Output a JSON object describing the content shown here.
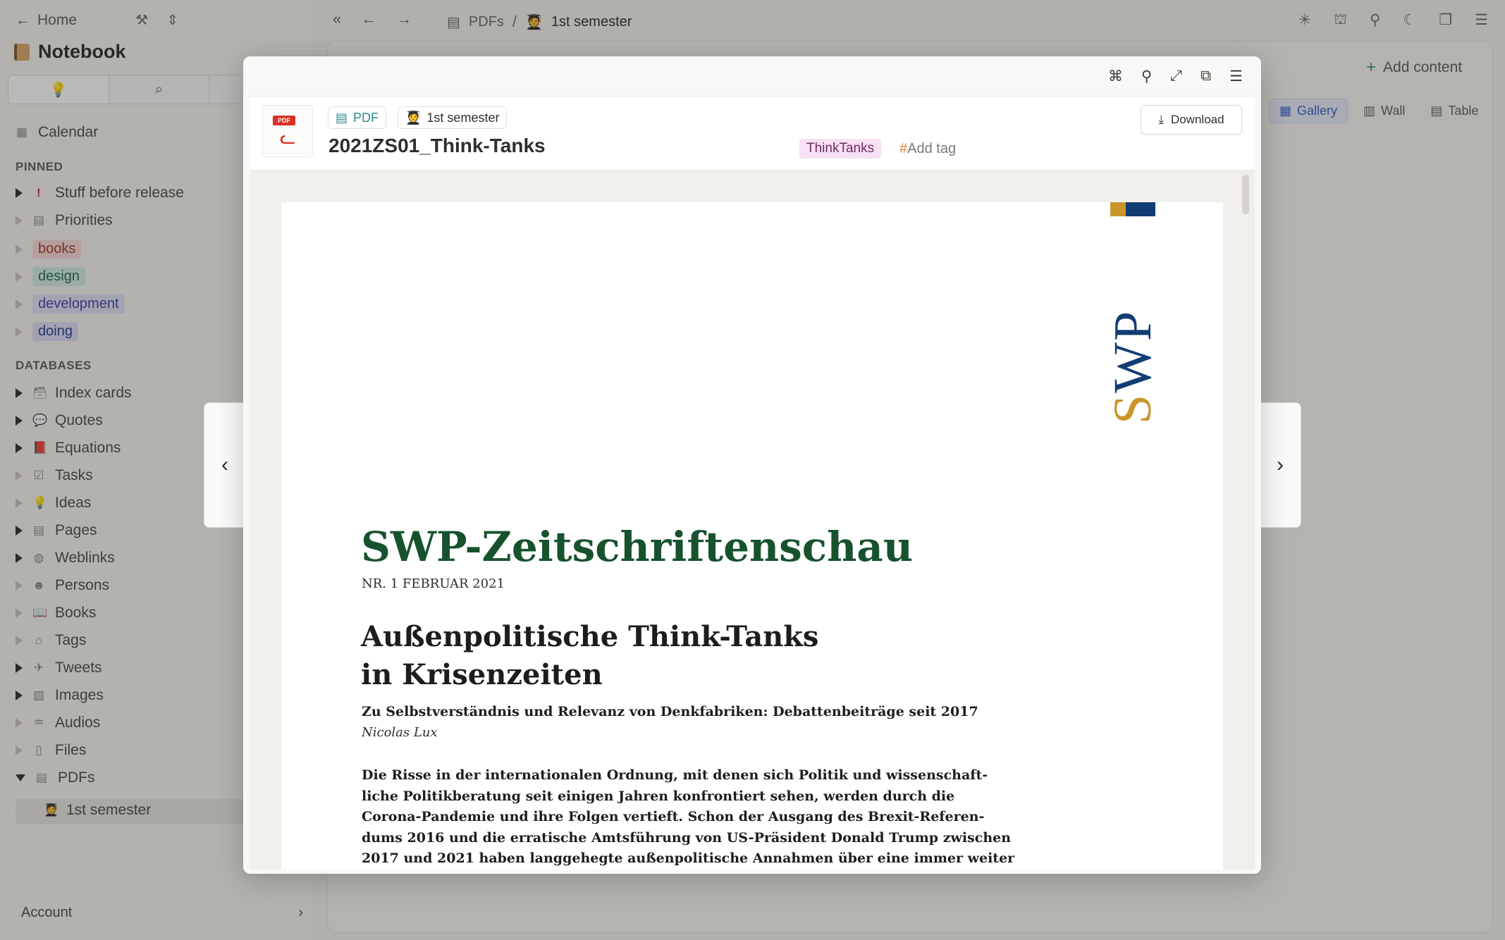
{
  "sidebar": {
    "home_label": "Home",
    "notebook_title": "Notebook",
    "tab_icons": [
      "lightbulb-icon",
      "search-icon"
    ],
    "calendar_label": "Calendar",
    "pinned_heading": "PINNED",
    "pinned": [
      {
        "label": "Stuff before release",
        "icon": "exclamation-icon"
      },
      {
        "label": "Priorities",
        "icon": "page-icon"
      },
      {
        "label": "books",
        "tag": true
      },
      {
        "label": "design",
        "tag": true
      },
      {
        "label": "development",
        "tag": true
      },
      {
        "label": "doing",
        "tag": true
      }
    ],
    "databases_heading": "DATABASES",
    "databases": [
      {
        "label": "Index cards",
        "icon": "card-box-icon"
      },
      {
        "label": "Quotes",
        "icon": "speech-bubble-icon"
      },
      {
        "label": "Equations",
        "icon": "red-book-icon"
      },
      {
        "label": "Tasks",
        "icon": "checkbox-icon"
      },
      {
        "label": "Ideas",
        "icon": "lightbulb-icon"
      },
      {
        "label": "Pages",
        "icon": "page-icon"
      },
      {
        "label": "Weblinks",
        "icon": "globe-icon"
      },
      {
        "label": "Persons",
        "icon": "person-face-icon"
      },
      {
        "label": "Books",
        "icon": "open-book-icon"
      },
      {
        "label": "Tags",
        "icon": "tag-icon"
      },
      {
        "label": "Tweets",
        "icon": "bird-icon"
      },
      {
        "label": "Images",
        "icon": "image-icon"
      },
      {
        "label": "Audios",
        "icon": "waveform-icon"
      },
      {
        "label": "Files",
        "icon": "file-icon"
      },
      {
        "label": "PDFs",
        "icon": "pdf-file-icon"
      }
    ],
    "selected_child": "1st semester",
    "account_label": "Account"
  },
  "topbar": {
    "crumb_root": "PDFs",
    "crumb_sep": "/",
    "crumb_current": "1st semester"
  },
  "main": {
    "add_content_label": "Add content",
    "views": {
      "gallery": "Gallery",
      "wall": "Wall",
      "table": "Table"
    }
  },
  "modal": {
    "pill_pdf": "PDF",
    "pill_collection": "1st semester",
    "doc_title": "2021ZS01_Think-Tanks",
    "tag": "ThinkTanks",
    "add_tag_label": "Add tag",
    "download_label": "Download",
    "thumb_badge": "PDF"
  },
  "pdf_page": {
    "logo_text": "SWP",
    "title": "SWP-Zeitschriftenschau",
    "issue": "NR. 1 FEBRUAR 2021",
    "heading_line1": "Außenpolitische Think-Tanks",
    "heading_line2": "in Krisenzeiten",
    "subtitle": "Zu Selbstverständnis und Relevanz von Denkfabriken: Debattenbeiträge seit 2017",
    "author": "Nicolas Lux",
    "body_lines": [
      "Die Risse in der internationalen Ordnung, mit denen sich Politik und wissenschaft-",
      "liche Politikberatung seit einigen Jahren konfrontiert sehen, werden durch die",
      "Corona-Pandemie und ihre Folgen vertieft. Schon der Ausgang des Brexit-Referen-",
      "dums 2016 und die erratische Amtsführung von US-Präsident Donald Trump zwischen",
      "2017 und 2021 haben langgehegte außenpolitische Annahmen über eine immer weiter"
    ]
  },
  "colors": {
    "pdf_title_green": "#17522e",
    "swp_gold": "#c8962b",
    "swp_blue": "#123d74",
    "accent_blue": "#3b5fc6"
  }
}
